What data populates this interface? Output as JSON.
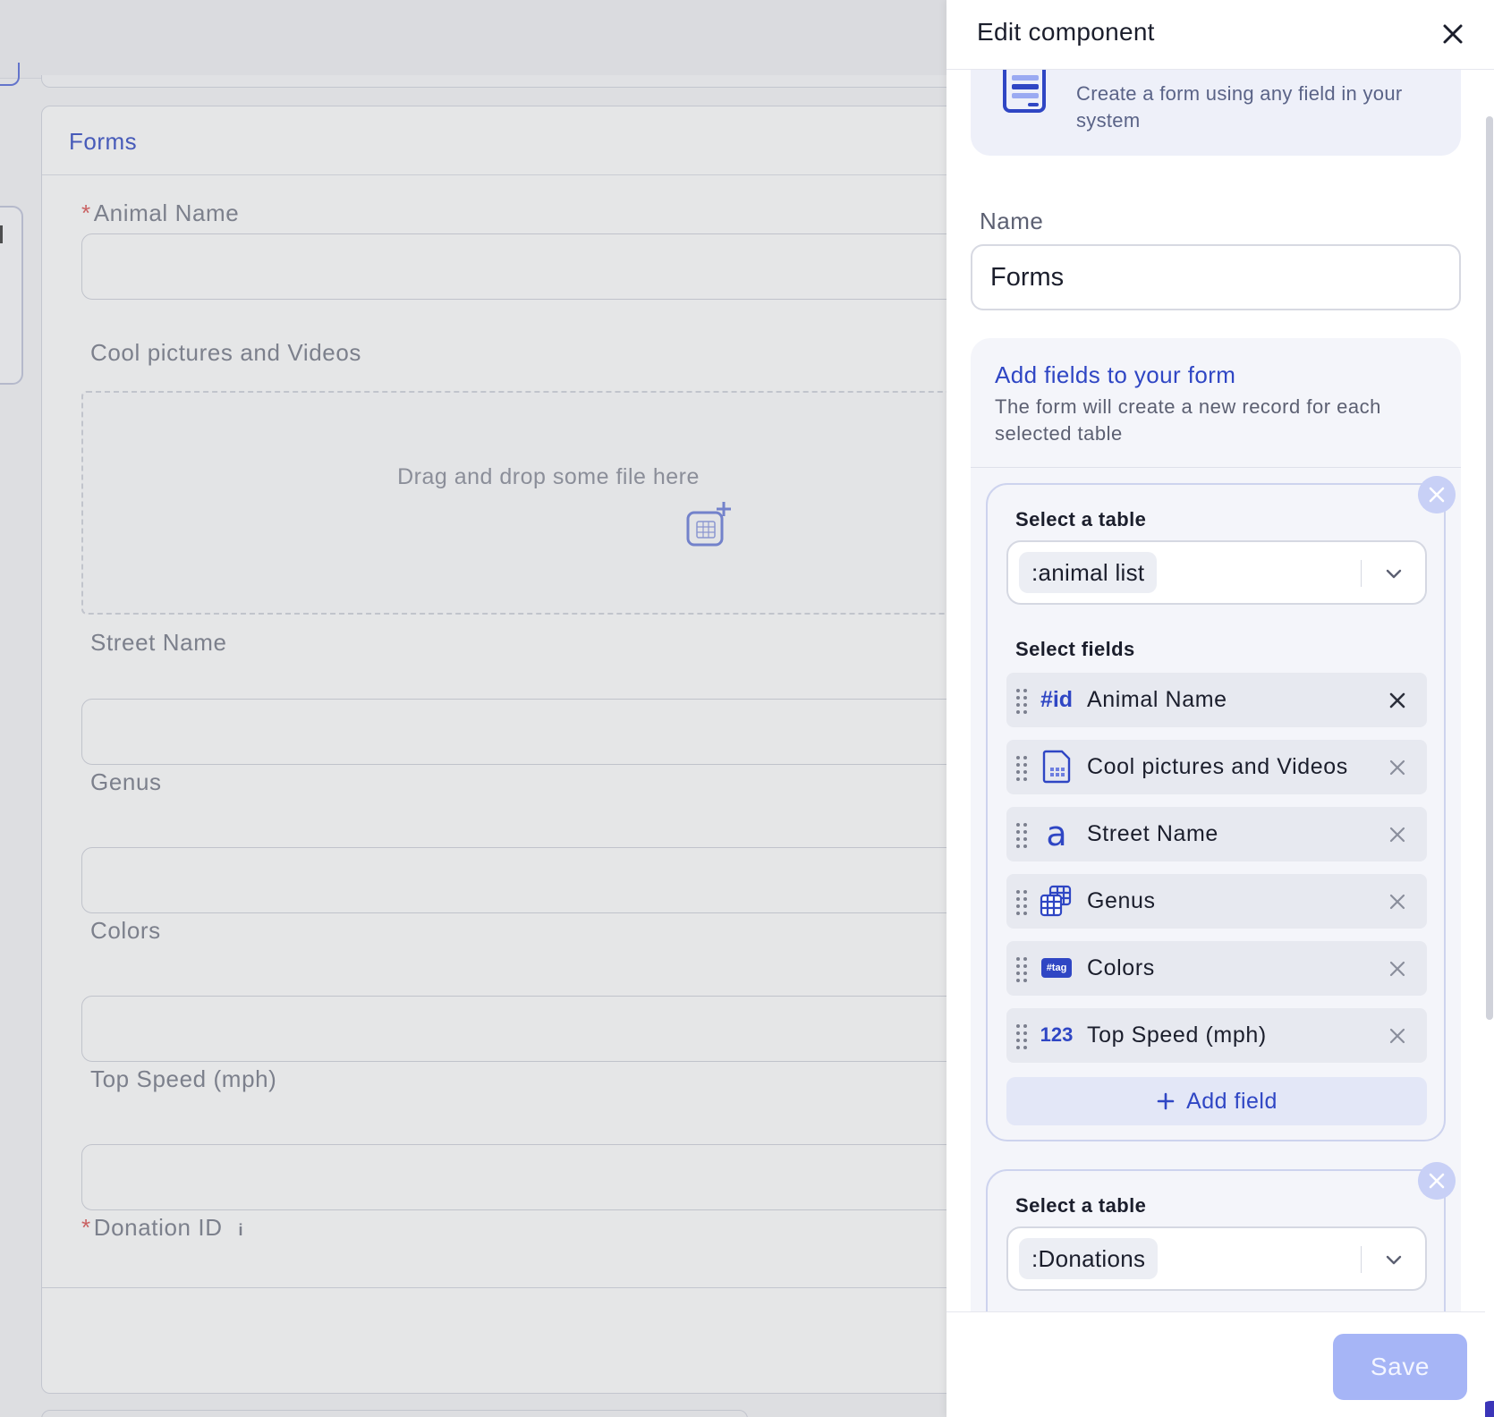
{
  "background": {
    "card_title": "Forms",
    "required_marker": "*",
    "fields": [
      {
        "label": "Animal Name",
        "required": true
      },
      {
        "label": "Cool pictures and Videos",
        "required": false
      },
      {
        "label": "Street Name",
        "required": false
      },
      {
        "label": "Genus",
        "required": false
      },
      {
        "label": "Colors",
        "required": false
      },
      {
        "label": "Top Speed (mph)",
        "required": false
      },
      {
        "label": "Donation ID",
        "required": true
      }
    ],
    "dropzone_text": "Drag and drop some file here",
    "info_glyph": "i"
  },
  "panel": {
    "title": "Edit component",
    "info_text": "Create a form using any field in your system",
    "name_label": "Name",
    "name_value": "Forms",
    "fields_section": {
      "title": "Add fields to your form",
      "description": "The form will create a new record for each selected table"
    },
    "table_cards": [
      {
        "select_label": "Select a table",
        "table_value": ":animal list",
        "fields_label": "Select fields",
        "fields": [
          {
            "icon": "id-icon",
            "icon_text": "#id",
            "name": "Animal Name"
          },
          {
            "icon": "file-icon",
            "icon_text": "",
            "name": "Cool pictures and Videos"
          },
          {
            "icon": "text-icon",
            "icon_text": "a",
            "name": "Street Name"
          },
          {
            "icon": "table-link-icon",
            "icon_text": "",
            "name": "Genus"
          },
          {
            "icon": "tag-icon",
            "icon_text": "#tag",
            "name": "Colors"
          },
          {
            "icon": "number-icon",
            "icon_text": "123",
            "name": "Top Speed (mph)"
          }
        ],
        "add_field_label": "Add field"
      },
      {
        "select_label": "Select a table",
        "table_value": ":Donations"
      }
    ],
    "save_label": "Save"
  },
  "colors": {
    "accent": "#2f46c4",
    "save_disabled": "#a6b5f6",
    "section_bg": "#f4f5fa"
  }
}
